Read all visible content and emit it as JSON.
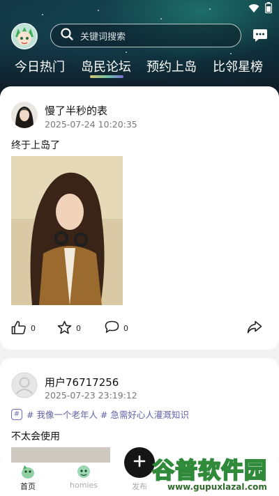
{
  "status_bar": {
    "icons": [
      "wifi-icon",
      "battery-icon"
    ]
  },
  "header": {
    "search": {
      "placeholder": "关键词搜索"
    },
    "tabs": [
      {
        "label": "今日热门",
        "active": false
      },
      {
        "label": "岛民论坛",
        "active": true
      },
      {
        "label": "预约上岛",
        "active": false
      },
      {
        "label": "比邻星榜",
        "active": false
      }
    ]
  },
  "posts": [
    {
      "user": "慢了半秒的表",
      "time": "2025-07-24 10:20:35",
      "text": "终于上岛了",
      "likes": "0",
      "favorites": "0",
      "comments": "0"
    },
    {
      "user": "用户76717256",
      "time": "2025-07-23 23:19:12",
      "topics": "# 我像一个老年人 # 急需好心人灌溉知识",
      "text": "不太会使用"
    }
  ],
  "bottom_nav": {
    "items": [
      {
        "label": "首页",
        "active": true
      },
      {
        "label": "homies",
        "active": false
      },
      {
        "label": "发布",
        "active": false
      }
    ]
  },
  "watermark": {
    "title": "谷普软件园",
    "url": "www.gupuxlazal.com"
  },
  "colors": {
    "accent": "#6063a8",
    "dark_header": "#10333d",
    "publish": "#151515"
  }
}
